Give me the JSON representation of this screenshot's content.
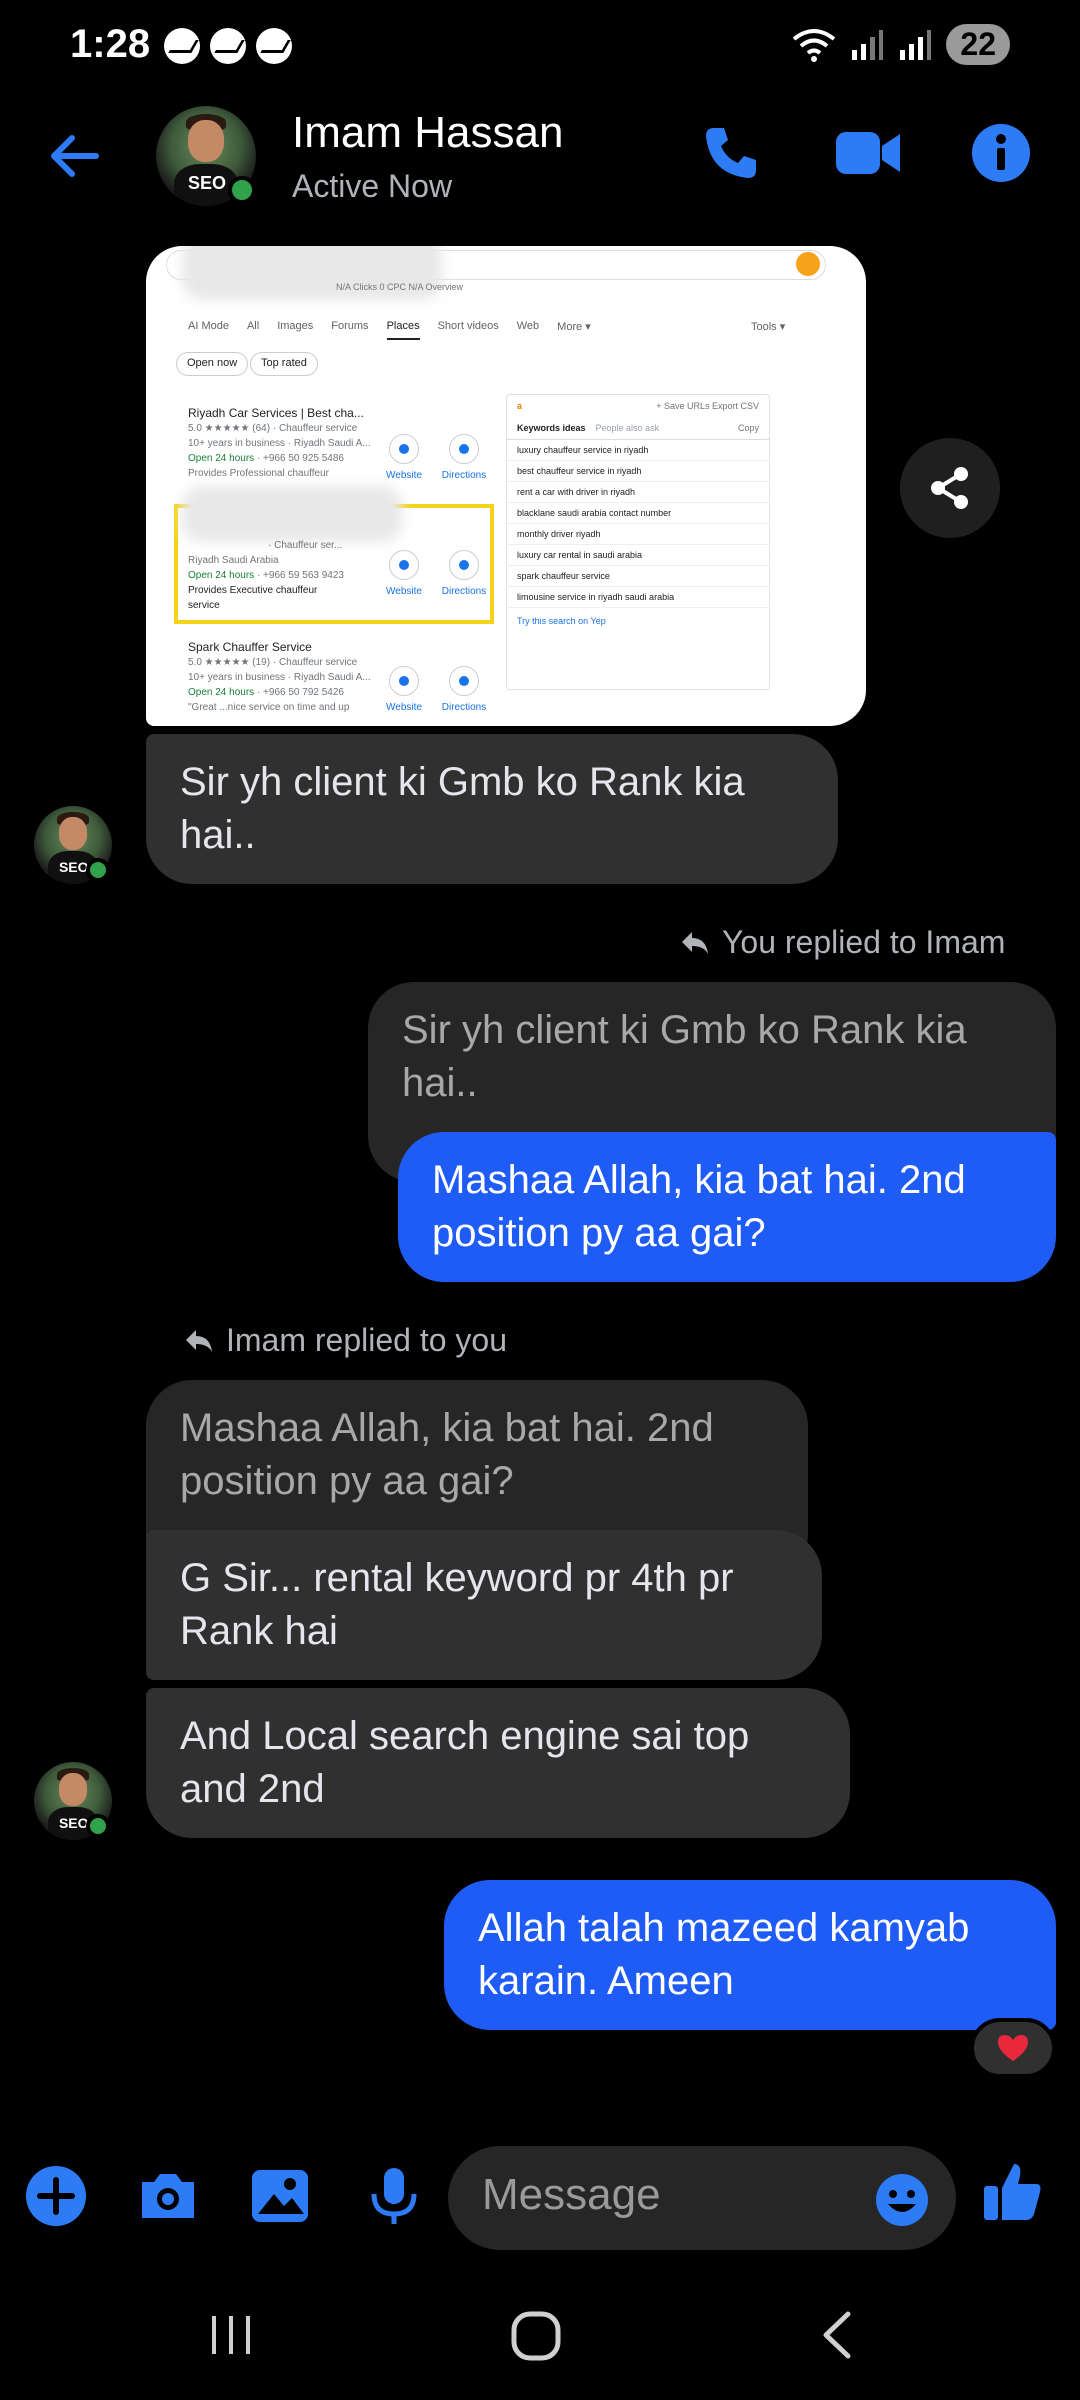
{
  "status_bar": {
    "time": "1:28",
    "battery": "22",
    "notification_icons": [
      "messenger-icon",
      "messenger-icon",
      "messenger-icon"
    ],
    "right_icons": [
      "wifi-icon",
      "signal-icon",
      "signal-icon"
    ]
  },
  "header": {
    "contact_name": "Imam Hassan",
    "status": "Active Now",
    "avatar_text": "SEO",
    "icons": [
      "back-arrow-icon",
      "phone-icon",
      "video-icon",
      "info-icon"
    ]
  },
  "shared_screenshot": {
    "tabs": [
      "AI Mode",
      "All",
      "Images",
      "Forums",
      "Places",
      "Short videos",
      "Web",
      "More ▾"
    ],
    "active_tab": "Places",
    "tools": "Tools ▾",
    "chips": [
      "Open now",
      "Top rated"
    ],
    "header_meta": "N/A  Clicks 0  CPC N/A  Overview",
    "places": [
      {
        "name": "Riyadh Car Services | Best cha...",
        "rating": "5.0 ★★★★★ (64) · Chauffeur service",
        "meta": "10+ years in business · Riyadh Saudi A...",
        "hours": "Open 24 hours",
        "phone": "· +966 50 925 5486",
        "provides": "Provides  Professional chauffeur"
      },
      {
        "name": "",
        "rating": "· Chauffeur ser...",
        "meta": "Riyadh Saudi Arabia",
        "hours": "Open 24 hours",
        "phone": "· +966 59 563 9423",
        "provides": "Provides  Executive chauffeur service"
      },
      {
        "name": "Spark Chauffer Service",
        "rating": "5.0 ★★★★★ (19) · Chauffeur service",
        "meta": "10+ years in business · Riyadh Saudi A...",
        "hours": "Open 24 hours",
        "phone": "· +966 50 792 5426",
        "provides": "\"Great ...nice service on time and up"
      }
    ],
    "place_buttons": [
      "Website",
      "Directions"
    ],
    "keyword_panel": {
      "toolbar": "+ Save URLs   Export CSV",
      "tabs": [
        "Keywords ideas",
        "People also ask"
      ],
      "copy": "Copy",
      "keywords": [
        "luxury chauffeur service in riyadh",
        "best chauffeur service in riyadh",
        "rent a car with driver in riyadh",
        "blacklane saudi arabia contact number",
        "monthly driver riyadh",
        "luxury car rental in saudi arabia",
        "spark chauffeur service",
        "limousine service in riyadh saudi arabia"
      ],
      "footer_link": "Try this search on Yep"
    }
  },
  "messages": [
    {
      "id": "m1",
      "direction": "in",
      "text": "Sir yh client ki Gmb ko Rank kia hai.."
    },
    {
      "id": "m2_label",
      "text": "You replied to Imam"
    },
    {
      "id": "m2_quote",
      "direction": "quote",
      "text": "Sir yh client ki Gmb ko Rank kia hai.."
    },
    {
      "id": "m2",
      "direction": "out",
      "text": "Mashaa Allah, kia bat hai. 2nd position py aa gai?"
    },
    {
      "id": "m3_label",
      "text": "Imam replied to you"
    },
    {
      "id": "m3_quote",
      "direction": "quote",
      "text": "Mashaa Allah, kia bat hai. 2nd position py aa gai?"
    },
    {
      "id": "m3",
      "direction": "in",
      "text": "G Sir... rental keyword pr 4th pr Rank hai"
    },
    {
      "id": "m4",
      "direction": "in",
      "text": "And Local search engine sai top and 2nd"
    },
    {
      "id": "m5",
      "direction": "out",
      "text": "Allah talah mazeed kamyab karain. Ameen",
      "reaction": "❤️"
    }
  ],
  "composer": {
    "placeholder": "Message",
    "icons": [
      "plus-icon",
      "camera-icon",
      "gallery-icon",
      "mic-icon",
      "emoji-icon",
      "thumbs-up-icon"
    ]
  },
  "nav_bar": {
    "icons": [
      "recents-icon",
      "home-icon",
      "back-icon"
    ]
  },
  "colors": {
    "accent": "#1f5cf5",
    "incoming_bubble": "#303030",
    "background": "#000000",
    "online": "#31a24c"
  }
}
